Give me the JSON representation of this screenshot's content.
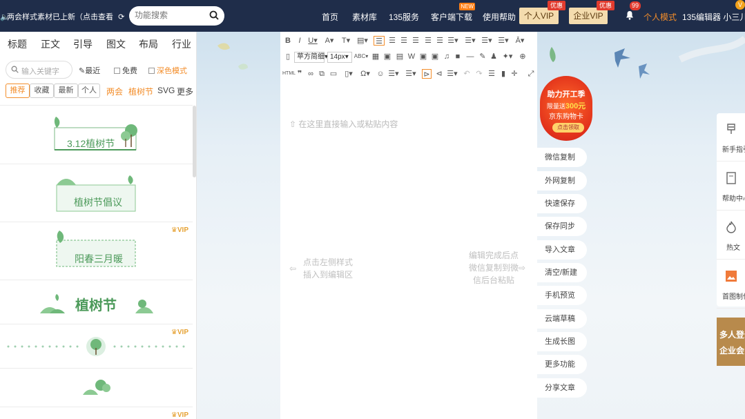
{
  "topbar": {
    "notice": "两会样式素材已上新（点击查看",
    "search_placeholder": "功能搜索",
    "nav": [
      "首页",
      "素材库",
      "135服务",
      "客户端下载",
      "使用帮助"
    ],
    "new_badge": "NEW",
    "vip_personal": "个人VIP",
    "vip_enterprise": "企业VIP",
    "vip_tag": "优惠",
    "bell_count": "99",
    "mode": "个人模式",
    "user": "135编辑器 小三儿",
    "avatar_badge": "V"
  },
  "left": {
    "tabs": [
      "标题",
      "正文",
      "引导",
      "图文",
      "布局",
      "行业"
    ],
    "search_placeholder": "输入关键字",
    "recent": "最近",
    "free": "免费",
    "dark": "深色模式",
    "pills": [
      "推荐",
      "收藏",
      "最新",
      "个人"
    ],
    "subcats": [
      "两会",
      "植树节",
      "SVG",
      "更多"
    ],
    "vip_label": "VIP",
    "templates": [
      {
        "text": "3.12植树节"
      },
      {
        "text": "植树节倡议"
      },
      {
        "text": "阳春三月暖",
        "vip": true
      },
      {
        "text": "植树节"
      },
      {
        "text": "",
        "vip": true
      },
      {
        "text": ""
      },
      {
        "text": "",
        "vip": true
      }
    ],
    "collapse_arrow": "‹"
  },
  "editor": {
    "font_name": "苹方简细",
    "font_size": "14px",
    "placeholder": "在这里直接输入或粘贴内容",
    "hint_left": [
      "点击左侧样式",
      "插入到编辑区"
    ],
    "hint_right": [
      "编辑完成后点",
      "微信复制到微",
      "信后台粘贴"
    ]
  },
  "promo": {
    "line1": "助力开工季",
    "line2_pre": "限量送",
    "line2_num": "300元",
    "line3": "京东购物卡",
    "button": "点击领取"
  },
  "actions": [
    "微信复制",
    "外网复制",
    "快速保存",
    "保存同步",
    "导入文章",
    "清空/新建",
    "手机预览",
    "云端草稿",
    "生成长图",
    "更多功能",
    "分享文章"
  ],
  "right_panel": {
    "items": [
      "新手指引",
      "帮助中心",
      "热文",
      "首图制作"
    ],
    "promo_lines": [
      "多人登录",
      "企业会员"
    ]
  },
  "colors": {
    "topbar": "#1f2d4a",
    "accent": "#f38d2a",
    "green": "#4c9a5a",
    "vip_gold": "#e6a234"
  }
}
